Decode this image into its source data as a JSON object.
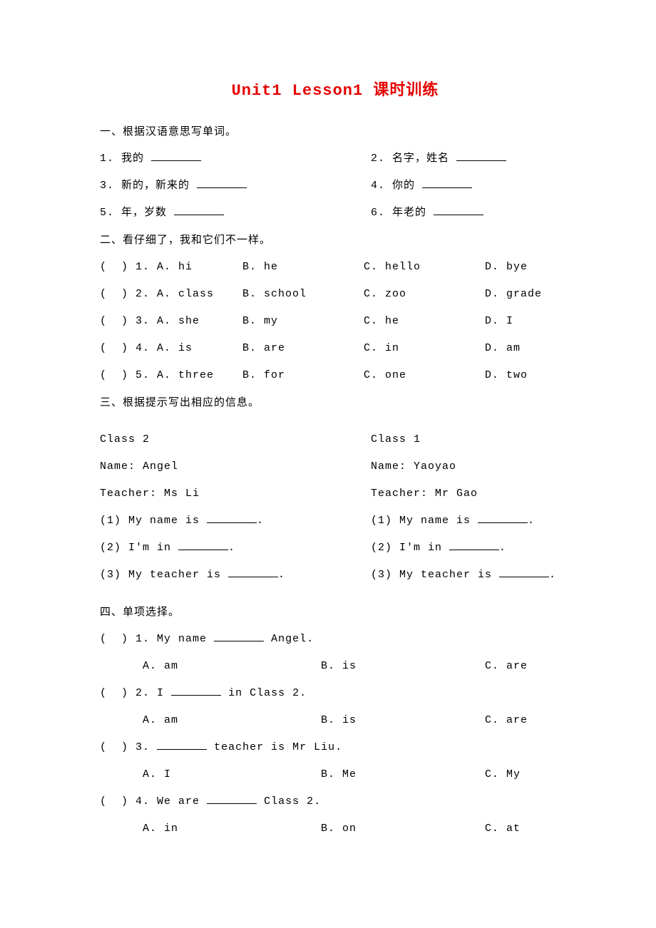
{
  "title": "Unit1 Lesson1 课时训练",
  "s1": {
    "heading": "一、根据汉语意思写单词。",
    "items": [
      {
        "n": "1.",
        "t": "我的"
      },
      {
        "n": "2.",
        "t": "名字，姓名"
      },
      {
        "n": "3.",
        "t": "新的，新来的"
      },
      {
        "n": "4.",
        "t": "你的"
      },
      {
        "n": "5.",
        "t": "年，岁数"
      },
      {
        "n": "6.",
        "t": "年老的"
      }
    ]
  },
  "s2": {
    "heading": "二、看仔细了，我和它们不一样。",
    "rows": [
      {
        "n": "1.",
        "a": "hi",
        "b": "he",
        "c": "hello",
        "d": "bye"
      },
      {
        "n": "2.",
        "a": "class",
        "b": "school",
        "c": "zoo",
        "d": "grade"
      },
      {
        "n": "3.",
        "a": "she",
        "b": "my",
        "c": "he",
        "d": "I"
      },
      {
        "n": "4.",
        "a": "is",
        "b": "are",
        "c": "in",
        "d": "am"
      },
      {
        "n": "5.",
        "a": "three",
        "b": "for",
        "c": "one",
        "d": "two"
      }
    ]
  },
  "s3": {
    "heading": "三、根据提示写出相应的信息。",
    "left": {
      "class": "Class 2",
      "name_label": "Name:",
      "name": "Angel",
      "teacher_label": "Teacher:",
      "teacher": "Ms Li",
      "q1": "(1) My name is",
      "q2": "(2) I'm in",
      "q3": "(3) My teacher is"
    },
    "right": {
      "class": "Class 1",
      "name_label": "Name:",
      "name": "Yaoyao",
      "teacher_label": "Teacher:",
      "teacher": "Mr Gao",
      "q1": "(1) My name is",
      "q2": "(2) I'm in",
      "q3": "(3) My teacher is"
    }
  },
  "s4": {
    "heading": "四、单项选择。",
    "questions": [
      {
        "n": "1.",
        "pre": "My name",
        "post": "Angel.",
        "a": "am",
        "b": "is",
        "c": "are"
      },
      {
        "n": "2.",
        "pre": "I",
        "post": "in Class 2.",
        "a": "am",
        "b": "is",
        "c": "are"
      },
      {
        "n": "3.",
        "pre": "",
        "post": "teacher is Mr Liu.",
        "a": "I",
        "b": "Me",
        "c": "My"
      },
      {
        "n": "4.",
        "pre": "We are",
        "post": "Class 2.",
        "a": "in",
        "b": "on",
        "c": "at"
      }
    ]
  }
}
